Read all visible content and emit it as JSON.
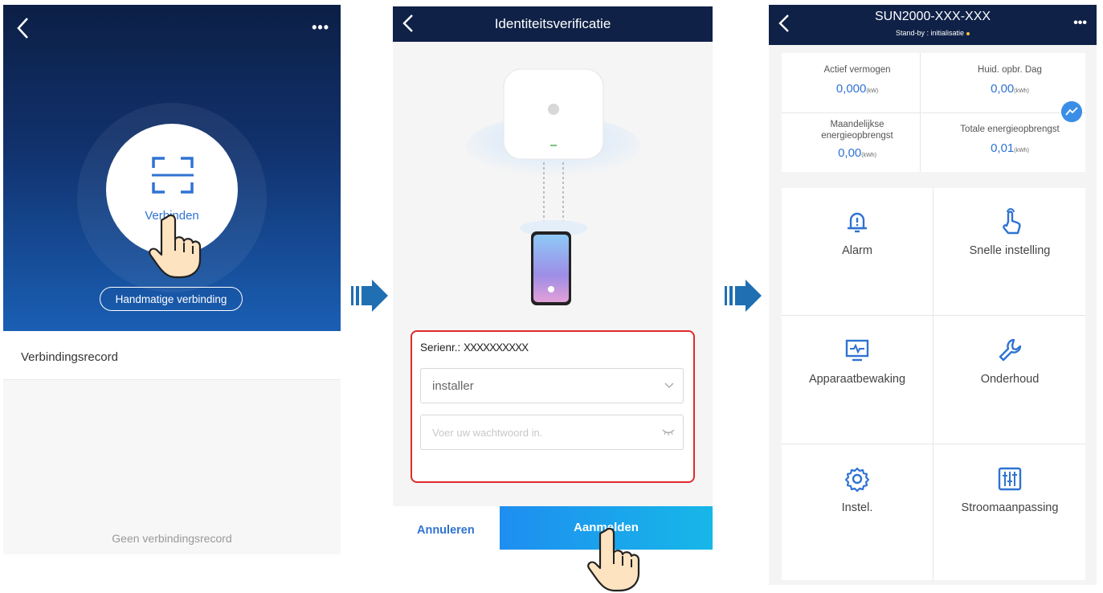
{
  "screen1": {
    "connect_label": "Verbinden",
    "manual_label": "Handmatige verbinding",
    "record_label": "Verbindingsrecord",
    "empty_label": "Geen verbindingsrecord",
    "icons": [
      "back-icon",
      "more-icon",
      "scan-icon",
      "hand-pointer-icon"
    ]
  },
  "screen2": {
    "title": "Identiteitsverificatie",
    "serial_label": "Serienr.:",
    "serial_value": "XXXXXXXXXX",
    "user_value": "installer",
    "password_placeholder": "Voer uw wachtwoord in.",
    "cancel_label": "Annuleren",
    "login_label": "Aanmelden",
    "highlight_color": "#e02a2a"
  },
  "screen3": {
    "device_name": "SUN2000-XXX-XXX",
    "status": "Stand-by : initialisatie",
    "stats": [
      {
        "label": "Actief vermogen",
        "value": "0,000",
        "unit": "(kW)"
      },
      {
        "label": "Huid. opbr. Dag",
        "value": "0,00",
        "unit": "(kWh)"
      },
      {
        "label": "Maandelijkse energieopbrengst",
        "value": "0,00",
        "unit": "(kWh)"
      },
      {
        "label": "Totale energieopbrengst",
        "value": "0,01",
        "unit": "(kWh)"
      }
    ],
    "tiles": [
      {
        "label": "Alarm",
        "icon": "alarm-bell-icon"
      },
      {
        "label": "Snelle instelling",
        "icon": "touch-icon"
      },
      {
        "label": "Apparaatbewaking",
        "icon": "monitor-icon"
      },
      {
        "label": "Onderhoud",
        "icon": "wrench-icon"
      },
      {
        "label": "Instel.",
        "icon": "gear-icon"
      },
      {
        "label": "Stroomaanpassing",
        "icon": "sliders-icon"
      }
    ]
  },
  "colors": {
    "navy": "#0f2147",
    "accent": "#2f73d3",
    "arrow": "#1f6fb2"
  }
}
